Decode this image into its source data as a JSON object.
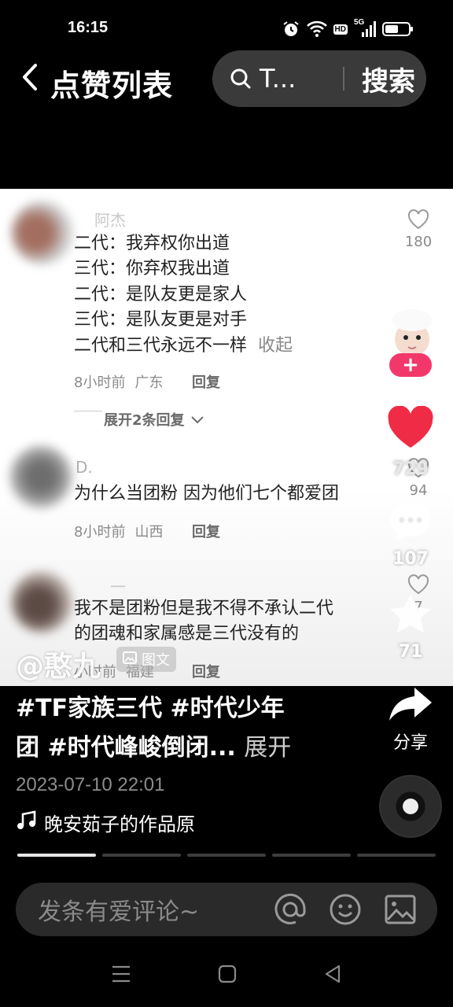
{
  "status_bar": {
    "time": "16:15",
    "icons": [
      "alarm-icon",
      "wifi-icon",
      "hd-badge",
      "5g-signal-icon",
      "battery-icon"
    ],
    "hd_label": "HD",
    "network_label": "5G"
  },
  "header": {
    "title": "点赞列表",
    "search_text": "T...",
    "search_button": "搜索"
  },
  "comments": [
    {
      "name": "阿杰",
      "lines": [
        "二代：我弃权你出道",
        "三代：你弃权我出道",
        "二代：是队友更是家人",
        "三代：是队友更是对手",
        "二代和三代永远不一样"
      ],
      "collapse_label": "收起",
      "time": "8小时前",
      "location": "广东",
      "reply_label": "回复",
      "likes": "180"
    },
    {
      "name": "D.",
      "lines": [
        "为什么当团粉 因为他们七个都爱团"
      ],
      "time": "8小时前",
      "location": "山西",
      "reply_label": "回复",
      "likes": "94"
    },
    {
      "name": "一",
      "lines": [
        "我不是团粉但是我不得不承认二代",
        "的团魂和家属感是三代没有的"
      ],
      "time": "小时前",
      "location": "福建",
      "reply_label": "回复",
      "likes": "7"
    }
  ],
  "expand_replies": "展开2条回复",
  "watermark": {
    "author": "@憨九",
    "badge": "图文"
  },
  "actions": {
    "follow_symbol": "+",
    "like_count": "729",
    "comment_count": "107",
    "favorite_count": "71",
    "share_label": "分享"
  },
  "post": {
    "hashtags_line1": "#TF家族三代 #时代少年",
    "hashtags_line2": "团 #时代峰峻倒闭...",
    "expand_label": "展开",
    "date": "2023-07-10 22:01",
    "music": "晚安茹子的作品原"
  },
  "progress": {
    "segments": 5,
    "active_index": 0
  },
  "comment_bar": {
    "placeholder": "发条有爱评论~"
  },
  "system_nav": [
    "menu-icon",
    "home-icon",
    "back-icon"
  ],
  "colors": {
    "background": "#000000",
    "accent_red": "#f2386a",
    "like_red": "#fe2c55"
  }
}
